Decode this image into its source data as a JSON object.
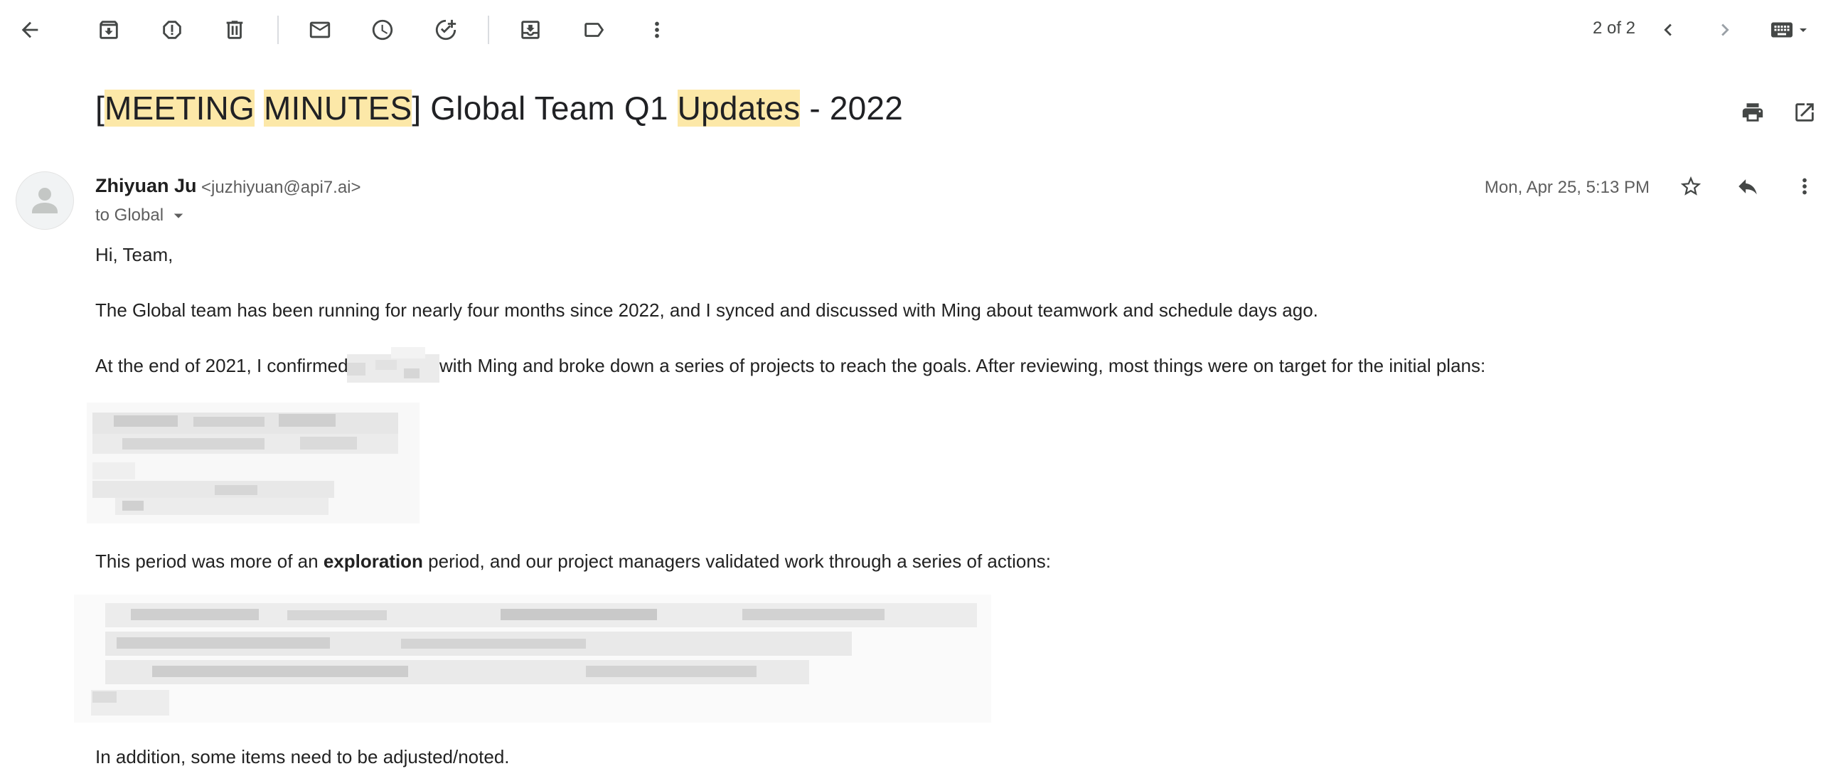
{
  "toolbar": {
    "counter": "2 of 2",
    "icons": [
      "back-arrow-icon",
      "archive-icon",
      "report-spam-icon",
      "delete-icon",
      "mark-unread-icon",
      "snooze-icon",
      "add-to-tasks-icon",
      "move-to-icon",
      "label-icon",
      "more-vertical-icon",
      "newer-chevron-icon",
      "older-chevron-icon",
      "keyboard-icon"
    ]
  },
  "subject": {
    "p1": "[",
    "h1": "MEETING",
    "p2": " ",
    "h2": "MINUTES",
    "p3": "] Global Team Q1 ",
    "h3": "Updates",
    "p4": " - 2022"
  },
  "message": {
    "sender_name": "Zhiyuan Ju",
    "sender_email": "<juzhiyuan@api7.ai>",
    "to_label": "to Global",
    "date": "Mon, Apr 25, 5:13 PM",
    "body": {
      "greeting": "Hi, Team,",
      "para1": "The Global team has been running for nearly four months since 2022, and I synced and discussed with Ming about teamwork and schedule days ago.",
      "para2_a": "At the end of 2021, I confirmed",
      "para2_b": "with Ming and broke down a series of projects to reach the goals. After reviewing, most things were on target for the initial plans:",
      "para3_a": "This period was more of an ",
      "para3_bold": "exploration",
      "para3_b": " period, and our project managers validated work through a series of actions:",
      "para4": "In addition, some items need to be adjusted/noted."
    }
  },
  "colors": {
    "highlight": "#fce8a8",
    "icon": "#444746",
    "text": "#222222",
    "meta": "#5e5e5e"
  }
}
